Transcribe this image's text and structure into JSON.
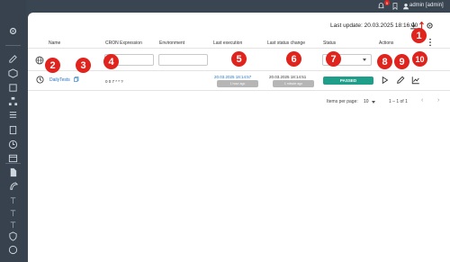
{
  "header": {
    "notification_count": "5",
    "user_label": "admin [admin]",
    "last_update": "Last update: 20.03.2025 18:16:00"
  },
  "table": {
    "columns": [
      "Name",
      "CRON Expression",
      "Environment",
      "Last execution",
      "Last status change",
      "Status",
      "Actions"
    ],
    "row": {
      "name": "DailyTests",
      "cron": "0 0 7 * * ?",
      "last_execution": "20.03.2025 18:14:57",
      "last_execution_chip": "1 hour ago",
      "last_status_change": "20.03.2025 18:14:51",
      "last_status_change_chip": "1 minute ago",
      "status": "PASSED"
    }
  },
  "pagination": {
    "items_per_page_label": "Items per page:",
    "items_per_page_value": "10",
    "range": "1 – 1 of 1"
  },
  "annotations": [
    "1",
    "2",
    "3",
    "4",
    "5",
    "6",
    "7",
    "8",
    "9",
    "10"
  ],
  "colors": {
    "sidebar": "#37424e",
    "link": "#1a73c8",
    "passed": "#1f9e8a",
    "annotation": "#e0231c"
  }
}
